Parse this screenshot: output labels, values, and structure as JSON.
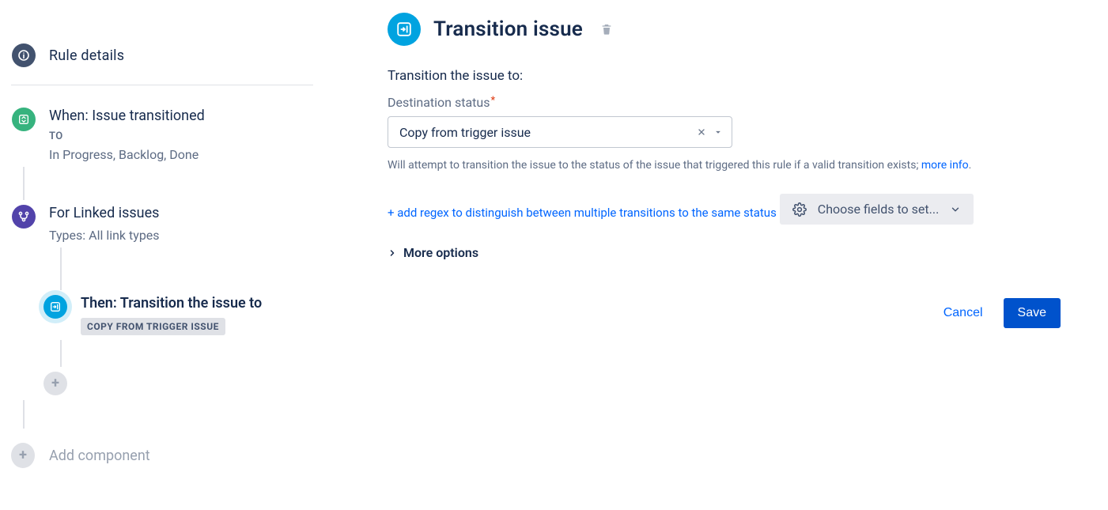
{
  "rail": {
    "rule_details": "Rule details",
    "trigger": {
      "title": "When: Issue transitioned",
      "to_label": "TO",
      "statuses": "In Progress, Backlog, Done"
    },
    "branch": {
      "title": "For Linked issues",
      "subtitle": "Types: All link types"
    },
    "action": {
      "title": "Then: Transition the issue to",
      "chip": "COPY FROM TRIGGER ISSUE"
    },
    "add_component": "Add component"
  },
  "main": {
    "title": "Transition issue",
    "lead": "Transition the issue to:",
    "dest_label": "Destination status",
    "dest_value": "Copy from trigger issue",
    "help_prefix": "Will attempt to transition the issue to the status of the issue that triggered this rule if a valid transition exists; ",
    "help_link": "more info",
    "help_suffix": ".",
    "add_regex": "+ add regex to distinguish between multiple transitions to the same status",
    "choose_fields": "Choose fields to set...",
    "more_options": "More options",
    "cancel": "Cancel",
    "save": "Save"
  },
  "icons": {
    "info": "info-icon",
    "transition": "transition-icon",
    "branch": "branch-icon",
    "plus": "plus-icon",
    "trash": "trash-icon",
    "clear": "clear-icon",
    "caret_down": "caret-down-icon",
    "gear": "gear-icon",
    "chevron_right": "chevron-right-icon"
  }
}
